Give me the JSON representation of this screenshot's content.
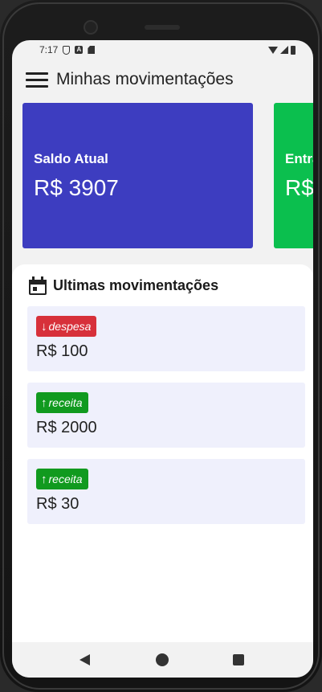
{
  "status_bar": {
    "time": "7:17",
    "icons": [
      "shield-icon",
      "a-icon",
      "sd-card-icon",
      "wifi-icon",
      "signal-icon",
      "battery-icon"
    ]
  },
  "app_bar": {
    "title": "Minhas movimentações",
    "menu_icon": "hamburger-menu-icon"
  },
  "summary_cards": [
    {
      "label": "Saldo Atual",
      "value": "R$ 3907",
      "color": "#3d3dc0"
    },
    {
      "label": "Entra",
      "value": "R$",
      "color": "#0bbf4e"
    }
  ],
  "recent": {
    "title": "Ultimas movimentações",
    "icon": "calendar-icon",
    "items": [
      {
        "type_label": "despesa",
        "direction": "down",
        "amount": "R$ 100",
        "badge_color": "#d7303a"
      },
      {
        "type_label": "receita",
        "direction": "up",
        "amount": "R$ 2000",
        "badge_color": "#119a1f"
      },
      {
        "type_label": "receita",
        "direction": "up",
        "amount": "R$ 30",
        "badge_color": "#119a1f"
      }
    ]
  },
  "nav_bar": {
    "icons": [
      "back-icon",
      "home-icon",
      "recents-icon"
    ]
  }
}
